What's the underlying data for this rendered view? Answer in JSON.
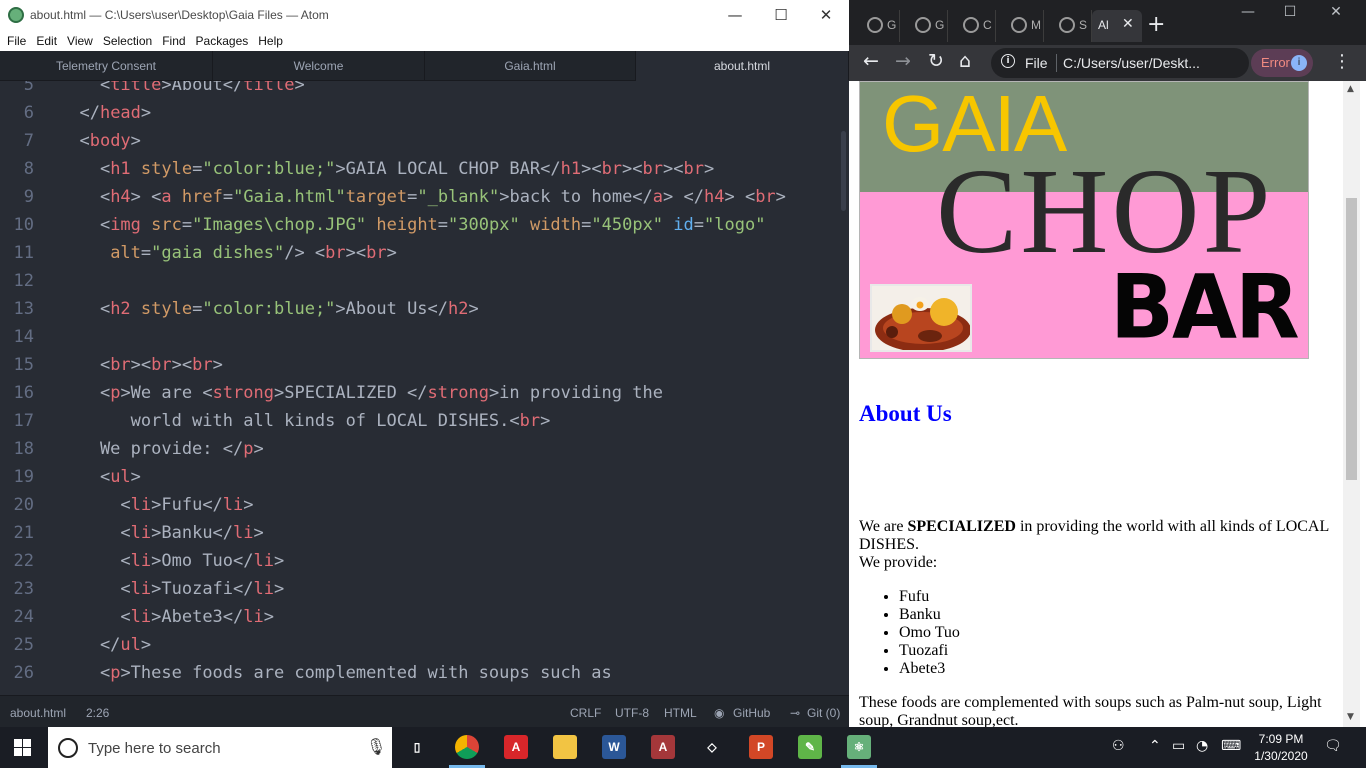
{
  "atom": {
    "title": "about.html — C:\\Users\\user\\Desktop\\Gaia Files — Atom",
    "menu": [
      "File",
      "Edit",
      "View",
      "Selection",
      "Find",
      "Packages",
      "Help"
    ],
    "tabs": [
      "Telemetry Consent",
      "Welcome",
      "Gaia.html",
      "about.html"
    ],
    "active_tab_index": 3,
    "status": {
      "file": "about.html",
      "cursor": "2:26",
      "line_ending": "CRLF",
      "encoding": "UTF-8",
      "grammar": "HTML",
      "github": "GitHub",
      "git": "Git (0)"
    },
    "code_lines": [
      {
        "n": "5",
        "tokens": [
          [
            "p",
            "    <"
          ],
          [
            "t",
            "title"
          ],
          [
            "p",
            ">About</"
          ],
          [
            "t",
            "title"
          ],
          [
            "p",
            ">"
          ]
        ]
      },
      {
        "n": "6",
        "tokens": [
          [
            "p",
            "  </"
          ],
          [
            "t",
            "head"
          ],
          [
            "p",
            ">"
          ]
        ]
      },
      {
        "n": "7",
        "tokens": [
          [
            "p",
            "  <"
          ],
          [
            "t",
            "body"
          ],
          [
            "p",
            ">"
          ]
        ]
      },
      {
        "n": "8",
        "tokens": [
          [
            "p",
            "    <"
          ],
          [
            "t",
            "h1"
          ],
          [
            "p",
            " "
          ],
          [
            "a",
            "style"
          ],
          [
            "p",
            "="
          ],
          [
            "s",
            "\"color:blue;\""
          ],
          [
            "p",
            ">GAIA LOCAL CHOP BAR</"
          ],
          [
            "t",
            "h1"
          ],
          [
            "p",
            "><"
          ],
          [
            "t",
            "br"
          ],
          [
            "p",
            "><"
          ],
          [
            "t",
            "br"
          ],
          [
            "p",
            "><"
          ],
          [
            "t",
            "br"
          ],
          [
            "p",
            ">"
          ]
        ]
      },
      {
        "n": "9",
        "tokens": [
          [
            "p",
            "    <"
          ],
          [
            "t",
            "h4"
          ],
          [
            "p",
            "> <"
          ],
          [
            "t",
            "a"
          ],
          [
            "p",
            " "
          ],
          [
            "a",
            "href"
          ],
          [
            "p",
            "="
          ],
          [
            "s",
            "\"Gaia.html\""
          ],
          [
            "a",
            "target"
          ],
          [
            "p",
            "="
          ],
          [
            "s",
            "\"_blank\""
          ],
          [
            "p",
            ">back to home</"
          ],
          [
            "t",
            "a"
          ],
          [
            "p",
            "> </"
          ],
          [
            "t",
            "h4"
          ],
          [
            "p",
            "> <"
          ],
          [
            "t",
            "br"
          ],
          [
            "p",
            ">"
          ]
        ]
      },
      {
        "n": "10",
        "tokens": [
          [
            "p",
            "    <"
          ],
          [
            "t",
            "img"
          ],
          [
            "p",
            " "
          ],
          [
            "a",
            "src"
          ],
          [
            "p",
            "="
          ],
          [
            "s",
            "\"Images\\chop.JPG\""
          ],
          [
            "p",
            " "
          ],
          [
            "a",
            "height"
          ],
          [
            "p",
            "="
          ],
          [
            "s",
            "\"300px\""
          ],
          [
            "p",
            " "
          ],
          [
            "a",
            "width"
          ],
          [
            "p",
            "="
          ],
          [
            "s",
            "\"450px\""
          ],
          [
            "p",
            " "
          ],
          [
            "i",
            "id"
          ],
          [
            "p",
            "="
          ],
          [
            "s",
            "\"logo\""
          ]
        ]
      },
      {
        "n": "11",
        "tokens": [
          [
            "p",
            "     "
          ],
          [
            "a",
            "alt"
          ],
          [
            "p",
            "="
          ],
          [
            "s",
            "\"gaia dishes\""
          ],
          [
            "p",
            "/> <"
          ],
          [
            "t",
            "br"
          ],
          [
            "p",
            "><"
          ],
          [
            "t",
            "br"
          ],
          [
            "p",
            ">"
          ]
        ]
      },
      {
        "n": "12",
        "tokens": [
          [
            "p",
            ""
          ]
        ]
      },
      {
        "n": "13",
        "tokens": [
          [
            "p",
            "    <"
          ],
          [
            "t",
            "h2"
          ],
          [
            "p",
            " "
          ],
          [
            "a",
            "style"
          ],
          [
            "p",
            "="
          ],
          [
            "s",
            "\"color:blue;\""
          ],
          [
            "p",
            ">About Us</"
          ],
          [
            "t",
            "h2"
          ],
          [
            "p",
            ">"
          ]
        ]
      },
      {
        "n": "14",
        "tokens": [
          [
            "p",
            ""
          ]
        ]
      },
      {
        "n": "15",
        "tokens": [
          [
            "p",
            "    <"
          ],
          [
            "t",
            "br"
          ],
          [
            "p",
            "><"
          ],
          [
            "t",
            "br"
          ],
          [
            "p",
            "><"
          ],
          [
            "t",
            "br"
          ],
          [
            "p",
            ">"
          ]
        ]
      },
      {
        "n": "16",
        "tokens": [
          [
            "p",
            "    <"
          ],
          [
            "t",
            "p"
          ],
          [
            "p",
            ">We are <"
          ],
          [
            "t",
            "strong"
          ],
          [
            "p",
            ">SPECIALIZED </"
          ],
          [
            "t",
            "strong"
          ],
          [
            "p",
            ">in providing the"
          ]
        ]
      },
      {
        "n": "17",
        "tokens": [
          [
            "p",
            "       world with all kinds of LOCAL DISHES.<"
          ],
          [
            "t",
            "br"
          ],
          [
            "p",
            ">"
          ]
        ]
      },
      {
        "n": "18",
        "tokens": [
          [
            "p",
            "    We provide: </"
          ],
          [
            "t",
            "p"
          ],
          [
            "p",
            ">"
          ]
        ]
      },
      {
        "n": "19",
        "tokens": [
          [
            "p",
            "    <"
          ],
          [
            "t",
            "ul"
          ],
          [
            "p",
            ">"
          ]
        ]
      },
      {
        "n": "20",
        "tokens": [
          [
            "p",
            "      <"
          ],
          [
            "t",
            "li"
          ],
          [
            "p",
            ">Fufu</"
          ],
          [
            "t",
            "li"
          ],
          [
            "p",
            ">"
          ]
        ]
      },
      {
        "n": "21",
        "tokens": [
          [
            "p",
            "      <"
          ],
          [
            "t",
            "li"
          ],
          [
            "p",
            ">Banku</"
          ],
          [
            "t",
            "li"
          ],
          [
            "p",
            ">"
          ]
        ]
      },
      {
        "n": "22",
        "tokens": [
          [
            "p",
            "      <"
          ],
          [
            "t",
            "li"
          ],
          [
            "p",
            ">Omo Tuo</"
          ],
          [
            "t",
            "li"
          ],
          [
            "p",
            ">"
          ]
        ]
      },
      {
        "n": "23",
        "tokens": [
          [
            "p",
            "      <"
          ],
          [
            "t",
            "li"
          ],
          [
            "p",
            ">Tuozafi</"
          ],
          [
            "t",
            "li"
          ],
          [
            "p",
            ">"
          ]
        ]
      },
      {
        "n": "24",
        "tokens": [
          [
            "p",
            "      <"
          ],
          [
            "t",
            "li"
          ],
          [
            "p",
            ">Abete3</"
          ],
          [
            "t",
            "li"
          ],
          [
            "p",
            ">"
          ]
        ]
      },
      {
        "n": "25",
        "tokens": [
          [
            "p",
            "    </"
          ],
          [
            "t",
            "ul"
          ],
          [
            "p",
            ">"
          ]
        ]
      },
      {
        "n": "26",
        "tokens": [
          [
            "p",
            "    <"
          ],
          [
            "t",
            "p"
          ],
          [
            "p",
            ">These foods are complemented with soups such as"
          ]
        ]
      }
    ]
  },
  "chrome": {
    "tabs": [
      {
        "label": "G",
        "favicon": "globe-icon"
      },
      {
        "label": "G",
        "favicon": "globe-icon"
      },
      {
        "label": "C",
        "favicon": "globe-icon"
      },
      {
        "label": "M",
        "favicon": "globe-icon"
      },
      {
        "label": "S",
        "favicon": "globe-icon"
      },
      {
        "label": "Al",
        "favicon": "globe-icon"
      }
    ],
    "omnibox": {
      "scheme": "File",
      "url": "C:/Users/user/Deskt..."
    },
    "profile_status": "Error",
    "profile_initial": "i",
    "page": {
      "logo_alt": "gaia dishes",
      "logo_words": {
        "top": "GAIA",
        "middle": "CHOP",
        "bottom": "BAR"
      },
      "h2": "About Us",
      "para1_pre": "We are ",
      "para1_strong": "SPECIALIZED",
      "para1_post": " in providing the world with all kinds of LOCAL DISHES.",
      "para1_line2": "We provide:",
      "list": [
        "Fufu",
        "Banku",
        "Omo Tuo",
        "Tuozafi",
        "Abete3"
      ],
      "para2": "These foods are complemented with soups such as Palm-nut soup, Light soup, Grandnut soup,ect."
    }
  },
  "taskbar": {
    "search_placeholder": "Type here to search",
    "apps": [
      {
        "name": "task-view",
        "glyph": "▯",
        "color": "#1a1d24"
      },
      {
        "name": "chrome",
        "glyph": "",
        "color": "#1a1d24"
      },
      {
        "name": "acrobat",
        "glyph": "A",
        "color": "#d8262a"
      },
      {
        "name": "file-explorer",
        "glyph": "",
        "color": "#f2c443"
      },
      {
        "name": "word",
        "glyph": "W",
        "color": "#2b5797"
      },
      {
        "name": "access",
        "glyph": "A",
        "color": "#a4373a"
      },
      {
        "name": "app-diamond",
        "glyph": "◇",
        "color": "#1a1d24"
      },
      {
        "name": "powerpoint",
        "glyph": "P",
        "color": "#d24726"
      },
      {
        "name": "notepadpp",
        "glyph": "✎",
        "color": "#5fb548"
      },
      {
        "name": "atom",
        "glyph": "⚛",
        "color": "#66b07a"
      }
    ],
    "time": "7:09 PM",
    "date": "1/30/2020"
  }
}
